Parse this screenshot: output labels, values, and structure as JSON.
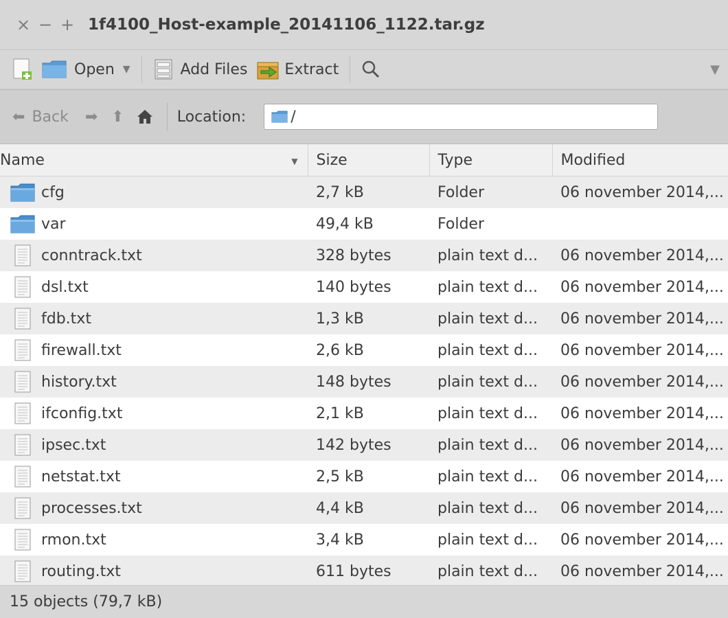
{
  "window": {
    "title": "1f4100_Host-example_20141106_1122.tar.gz",
    "controls": [
      "×",
      "−",
      "+"
    ]
  },
  "toolbar": {
    "open_label": "Open",
    "add_files_label": "Add Files",
    "extract_label": "Extract"
  },
  "nav": {
    "back_label": "Back",
    "location_label": "Location:",
    "location_value": "/"
  },
  "columns": {
    "name": "Name",
    "size": "Size",
    "type": "Type",
    "modified": "Modified"
  },
  "files": [
    {
      "name": "cfg",
      "size": "2,7 kB",
      "type": "Folder",
      "modified": "06 november 2014,...",
      "icon": "folder-icon"
    },
    {
      "name": "var",
      "size": "49,4 kB",
      "type": "Folder",
      "modified": "",
      "icon": "folder-icon"
    },
    {
      "name": "conntrack.txt",
      "size": "328 bytes",
      "type": "plain text d...",
      "modified": "06 november 2014,...",
      "icon": "text-file-icon"
    },
    {
      "name": "dsl.txt",
      "size": "140 bytes",
      "type": "plain text d...",
      "modified": "06 november 2014,...",
      "icon": "text-file-icon"
    },
    {
      "name": "fdb.txt",
      "size": "1,3 kB",
      "type": "plain text d...",
      "modified": "06 november 2014,...",
      "icon": "text-file-icon"
    },
    {
      "name": "firewall.txt",
      "size": "2,6 kB",
      "type": "plain text d...",
      "modified": "06 november 2014,...",
      "icon": "text-file-icon"
    },
    {
      "name": "history.txt",
      "size": "148 bytes",
      "type": "plain text d...",
      "modified": "06 november 2014,...",
      "icon": "text-file-icon"
    },
    {
      "name": "ifconfig.txt",
      "size": "2,1 kB",
      "type": "plain text d...",
      "modified": "06 november 2014,...",
      "icon": "text-file-icon"
    },
    {
      "name": "ipsec.txt",
      "size": "142 bytes",
      "type": "plain text d...",
      "modified": "06 november 2014,...",
      "icon": "text-file-icon"
    },
    {
      "name": "netstat.txt",
      "size": "2,5 kB",
      "type": "plain text d...",
      "modified": "06 november 2014,...",
      "icon": "text-file-icon"
    },
    {
      "name": "processes.txt",
      "size": "4,4 kB",
      "type": "plain text d...",
      "modified": "06 november 2014,...",
      "icon": "text-file-icon"
    },
    {
      "name": "rmon.txt",
      "size": "3,4 kB",
      "type": "plain text d...",
      "modified": "06 november 2014,...",
      "icon": "text-file-icon"
    },
    {
      "name": "routing.txt",
      "size": "611 bytes",
      "type": "plain text d...",
      "modified": "06 november 2014,...",
      "icon": "text-file-icon"
    }
  ],
  "status": {
    "text": "15 objects (79,7 kB)"
  },
  "colors": {
    "chrome_bg": "#d7d7d7",
    "row_alt": "#ececec",
    "folder_blue": "#5b9bd5"
  }
}
